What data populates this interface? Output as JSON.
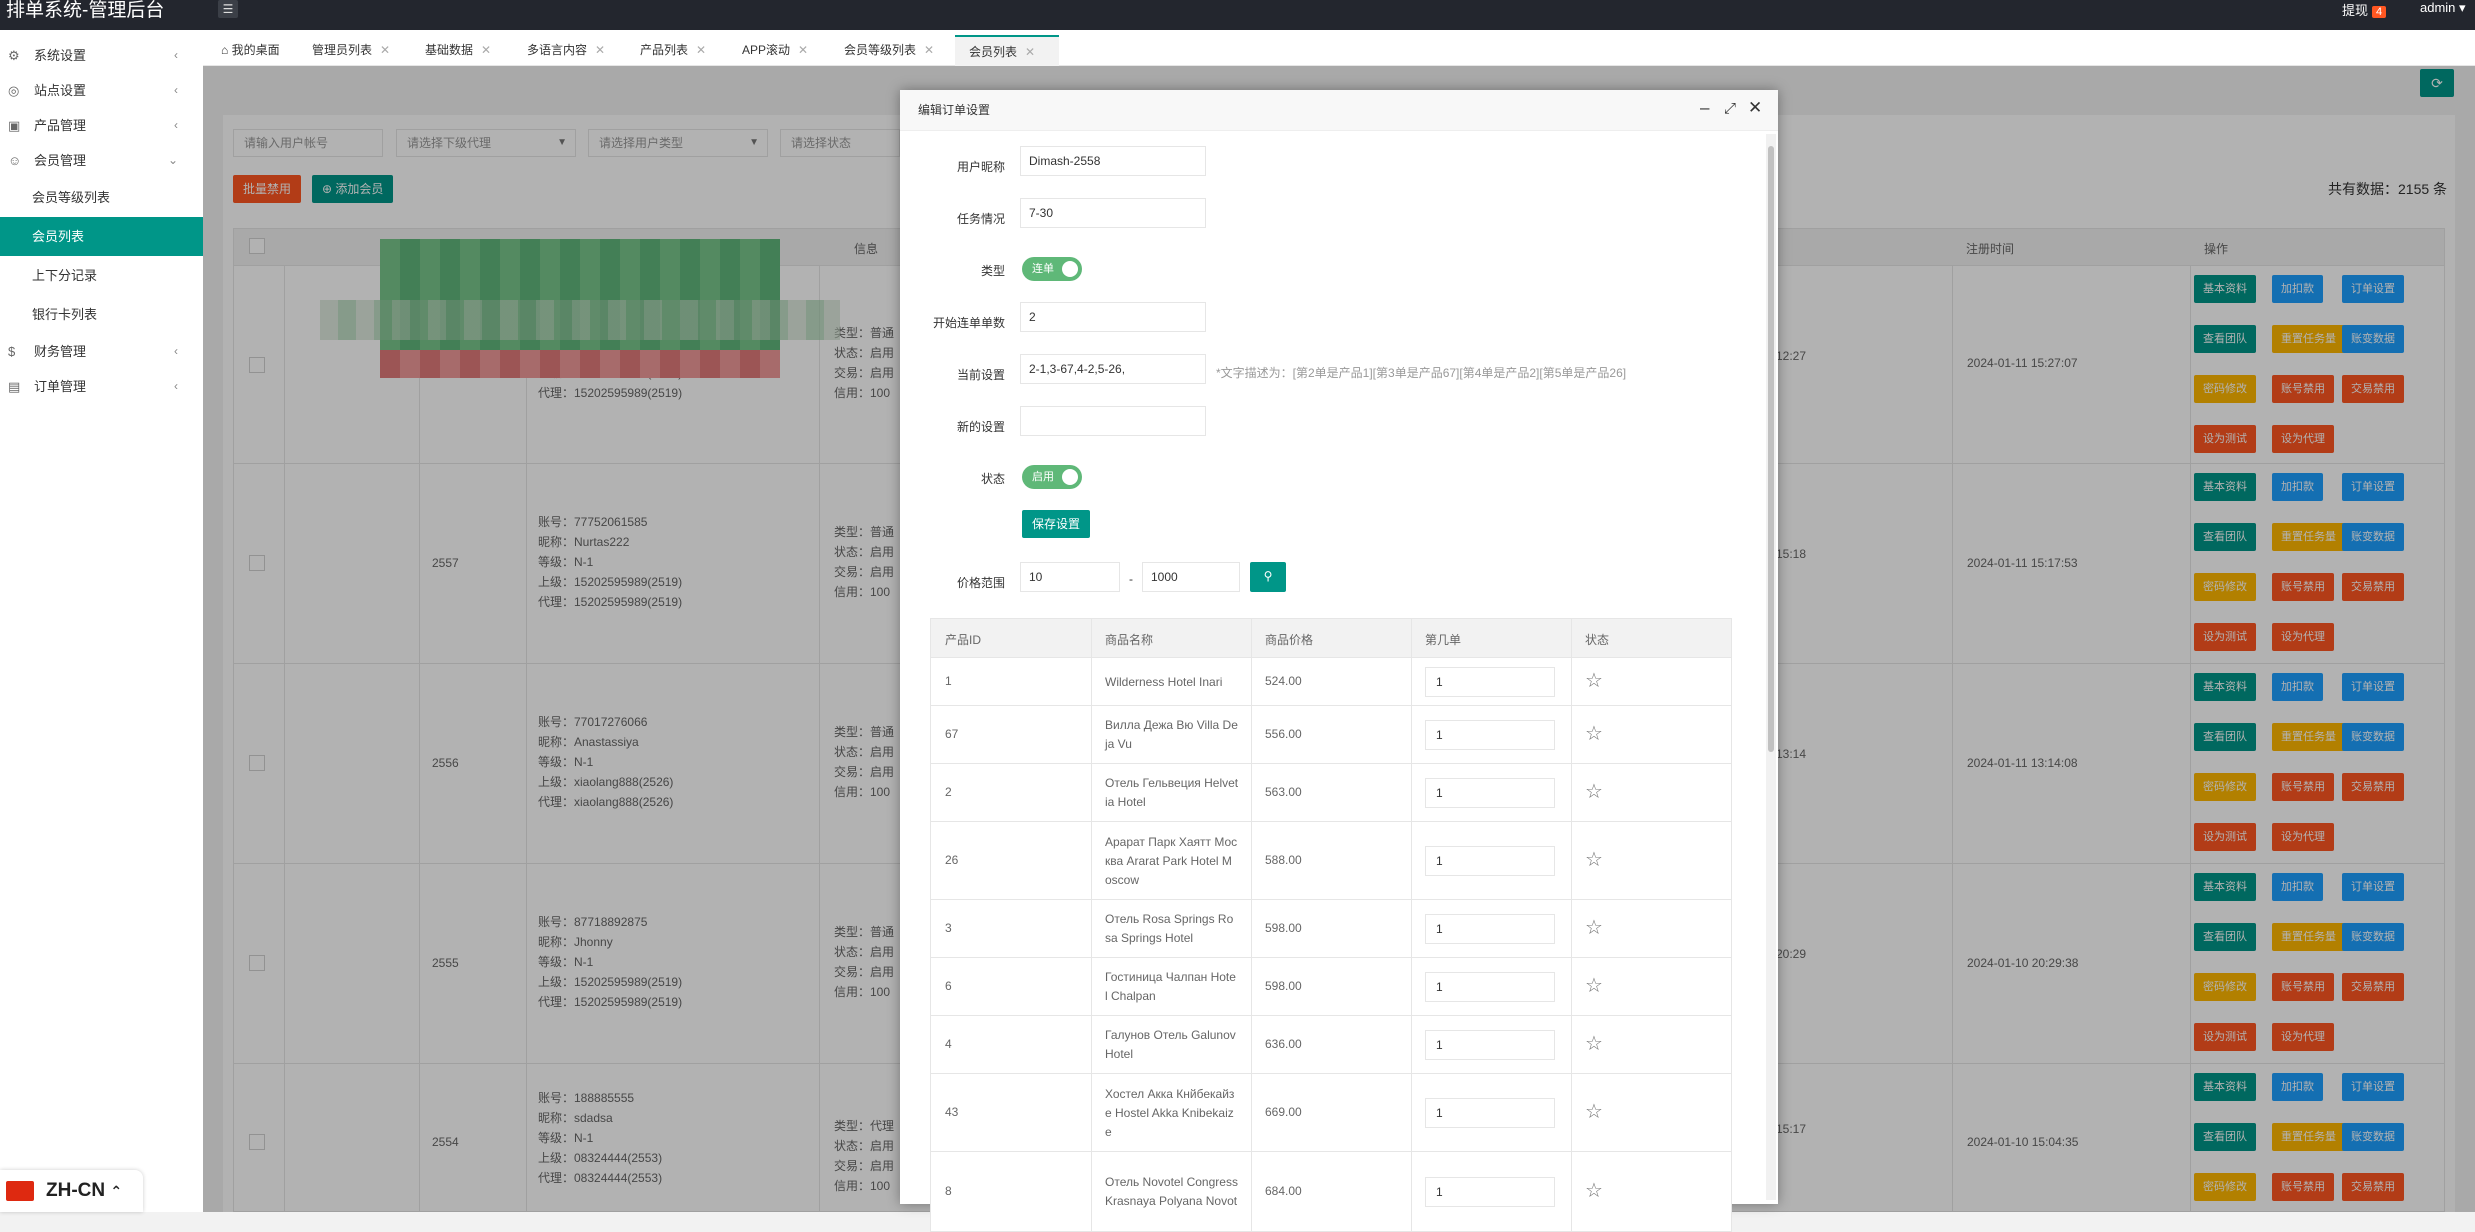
{
  "app": {
    "title": "排单系统-管理后台",
    "notice_label": "提现",
    "notice_count": "4",
    "user": "admin"
  },
  "sidebar": {
    "groups": [
      {
        "label": "系统设置",
        "icon": "gear-icon"
      },
      {
        "label": "站点设置",
        "icon": "settings-icon"
      },
      {
        "label": "产品管理",
        "icon": "box-icon"
      },
      {
        "label": "会员管理",
        "icon": "user-icon"
      }
    ],
    "subitems": [
      "会员等级列表",
      "会员列表",
      "上下分记录",
      "银行卡列表"
    ],
    "groups2": [
      {
        "label": "财务管理",
        "icon": "money-icon"
      },
      {
        "label": "订单管理",
        "icon": "order-icon"
      }
    ]
  },
  "tabs": [
    {
      "label": "我的桌面"
    },
    {
      "label": "管理员列表"
    },
    {
      "label": "基础数据"
    },
    {
      "label": "多语言内容"
    },
    {
      "label": "产品列表"
    },
    {
      "label": "APP滚动"
    },
    {
      "label": "会员等级列表"
    },
    {
      "label": "会员列表"
    }
  ],
  "filters": {
    "search_placeholder": "请输入用户帐号",
    "agent": "请选择下级代理",
    "user_type": "请选择用户类型",
    "status": "请选择状态"
  },
  "toolbar": {
    "batch_disable": "批量禁用",
    "add_member": "添加会员"
  },
  "total": "共有数据：2155 条",
  "table": {
    "headers": {
      "info": "信息",
      "register_time": "注册时间",
      "actions": "操作"
    },
    "rows": [
      {
        "id": "",
        "account": "",
        "user_lines": "上级：15202595989(2519)\n代理：15202595989(2519)",
        "status_lines": "类型：普通\n状态：启用\n交易：启用\n信用：100",
        "time_short": "12:27",
        "reg_time": "2024-01-11 15:27:07"
      },
      {
        "id": "2557",
        "user_lines": "账号：77752061585\n昵称：Nurtas222\n等级：N-1\n上级：15202595989(2519)\n代理：15202595989(2519)",
        "status_lines": "类型：普通\n状态：启用\n交易：启用\n信用：100",
        "time_short": "15:18",
        "reg_time": "2024-01-11 15:17:53"
      },
      {
        "id": "2556",
        "user_lines": "账号：77017276066\n昵称：Anastassiya\n等级：N-1\n上级：xiaolang888(2526)\n代理：xiaolang888(2526)",
        "status_lines": "类型：普通\n状态：启用\n交易：启用\n信用：100",
        "time_short": "13:14",
        "reg_time": "2024-01-11 13:14:08"
      },
      {
        "id": "2555",
        "user_lines": "账号：87718892875\n昵称：Jhonny\n等级：N-1\n上级：15202595989(2519)\n代理：15202595989(2519)",
        "status_lines": "类型：普通\n状态：启用\n交易：启用\n信用：100",
        "time_short": "20:29",
        "reg_time": "2024-01-10 20:29:38"
      },
      {
        "id": "2554",
        "user_lines": "账号：188885555\n昵称：sdadsa\n等级：N-1\n上级：08324444(2553)\n代理：08324444(2553)",
        "status_lines": "类型：代理\n状态：启用\n交易：启用\n信用：100",
        "time_short": "15:17",
        "reg_time": "2024-01-10 15:04:35"
      }
    ],
    "action_labels": {
      "basic": "基本资料",
      "add_deduct": "加扣款",
      "order_settings": "订单设置",
      "view_team": "查看团队",
      "reset_tasks": "重置任务量",
      "account_data": "账变数据",
      "modify_pwd": "密码修改",
      "disable_account": "账号禁用",
      "disable_trade": "交易禁用",
      "set_test": "设为测试",
      "set_agent": "设为代理"
    }
  },
  "modal": {
    "title": "编辑订单设置",
    "labels": {
      "nickname": "用户昵称",
      "task": "任务情况",
      "type": "类型",
      "start": "开始连单单数",
      "current": "当前设置",
      "new": "新的设置",
      "status": "状态",
      "price_range": "价格范围"
    },
    "values": {
      "nickname": "Dimash-2558",
      "task": "7-30",
      "start": "2",
      "current": "2-1,3-67,4-2,5-26,",
      "new": "",
      "price_min": "10",
      "price_max": "1000"
    },
    "type_switch": "连单",
    "status_switch": "启用",
    "hint": "*文字描述为：[第2单是产品1][第3单是产品67][第4单是产品2][第5单是产品26]",
    "save": "保存设置",
    "dash": "-",
    "product_table": {
      "headers": [
        "产品ID",
        "商品名称",
        "商品价格",
        "第几单",
        "状态"
      ],
      "rows": [
        {
          "id": "1",
          "name": "Wilderness Hotel Inari",
          "price": "524.00",
          "order": "1"
        },
        {
          "id": "67",
          "name": "Вилла Дежа Вю Villa De\nja Vu",
          "price": "556.00",
          "order": "1"
        },
        {
          "id": "2",
          "name": "Отель Гельвеция Helvet\nia Hotel",
          "price": "563.00",
          "order": "1"
        },
        {
          "id": "26",
          "name": "Арарат Парк Хаятт Мос\nква Ararat Park Hotel M\noscow",
          "price": "588.00",
          "order": "1"
        },
        {
          "id": "3",
          "name": "Отель Rosa Springs Ro\nsa Springs Hotel",
          "price": "598.00",
          "order": "1"
        },
        {
          "id": "6",
          "name": "Гостиница Чалпан Hote\nl Chalpan",
          "price": "598.00",
          "order": "1"
        },
        {
          "id": "4",
          "name": "Галунов Отель Galunov\nHotel",
          "price": "636.00",
          "order": "1"
        },
        {
          "id": "43",
          "name": "Хостел Акка Кнйбекайз\ne Hostel Akka Knibekaiz\ne",
          "price": "669.00",
          "order": "1"
        },
        {
          "id": "8",
          "name": "Отель Novotel Congress\nKrasnaya Polyana Novot",
          "price": "684.00",
          "order": "1"
        }
      ]
    }
  },
  "lang": "ZH-CN"
}
